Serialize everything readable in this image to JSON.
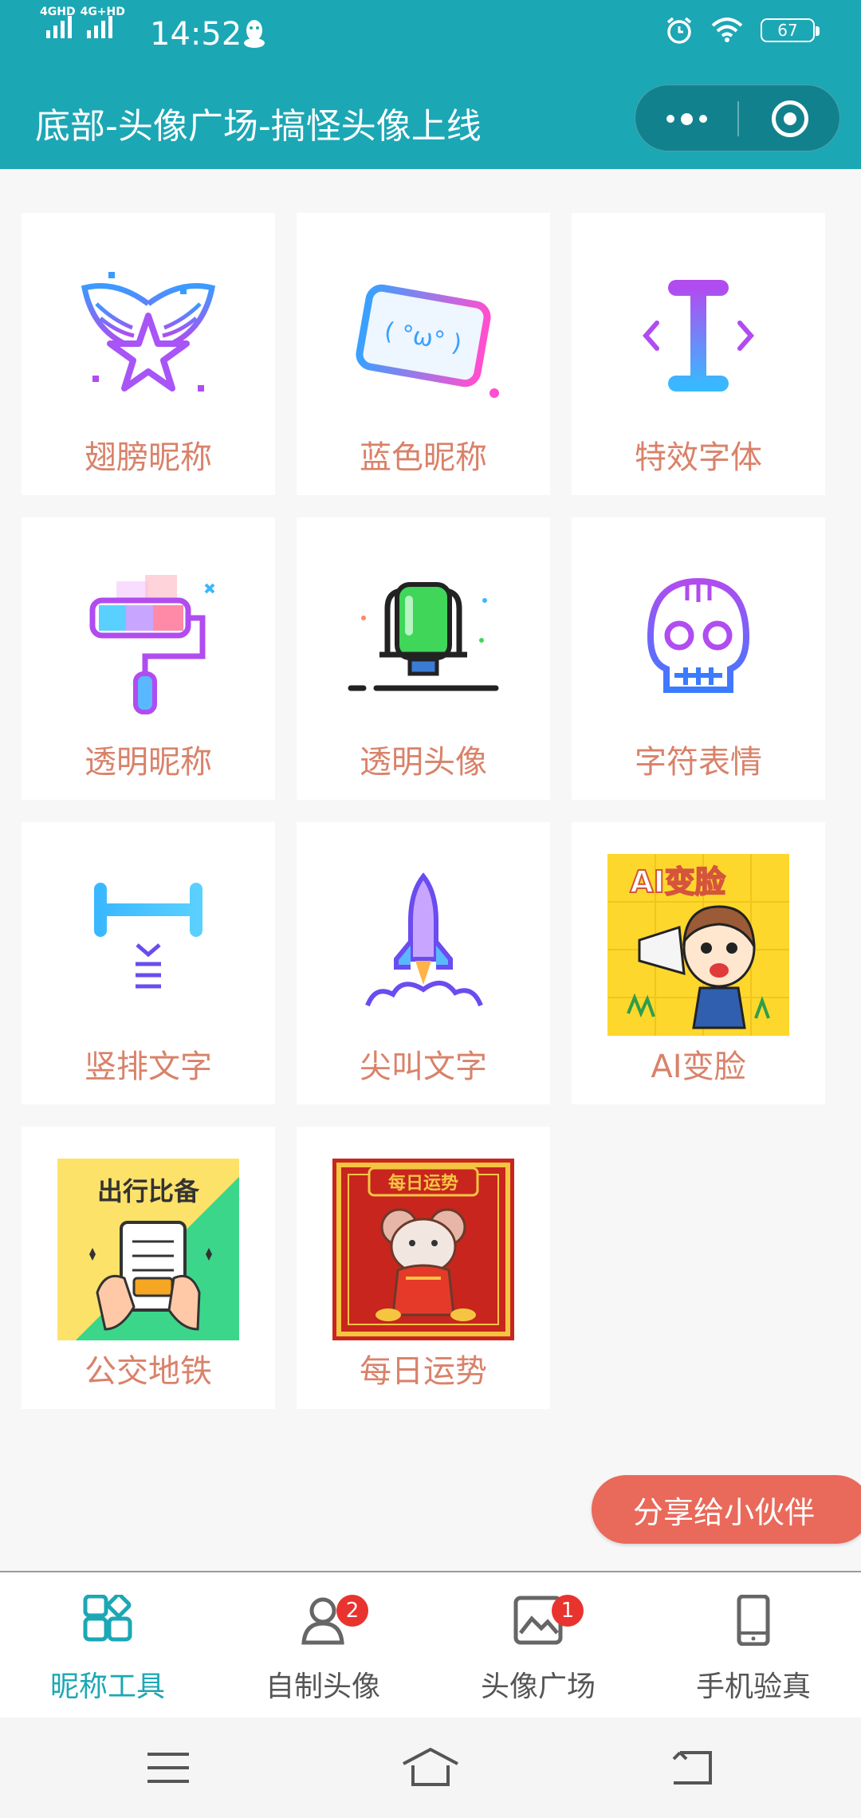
{
  "status_bar": {
    "network_1": "4GHD",
    "network_2": "4G+HD",
    "time": "14:52",
    "battery": "67"
  },
  "title_bar": {
    "title": "底部-头像广场-搞怪头像上线",
    "more_icon": "more-dots-icon",
    "close_icon": "target-close-icon"
  },
  "tools": [
    {
      "label": "翅膀昵称",
      "icon": "winged-star-icon"
    },
    {
      "label": "蓝色昵称",
      "icon": "kaomoji-tag-icon"
    },
    {
      "label": "特效字体",
      "icon": "text-cursor-icon"
    },
    {
      "label": "透明昵称",
      "icon": "paint-roller-icon"
    },
    {
      "label": "透明头像",
      "icon": "green-stamp-icon"
    },
    {
      "label": "字符表情",
      "icon": "skull-icon"
    },
    {
      "label": "竖排文字",
      "icon": "vertical-text-icon"
    },
    {
      "label": "尖叫文字",
      "icon": "rocket-icon"
    },
    {
      "label": "AI变脸",
      "icon": "ai-face-thumbnail",
      "image_text": "AI变脸"
    },
    {
      "label": "公交地铁",
      "icon": "transit-thumbnail",
      "image_text": "出行比备"
    },
    {
      "label": "每日运势",
      "icon": "fortune-thumbnail",
      "image_text": "每日运势"
    }
  ],
  "share_button": "分享给小伙伴",
  "tabs": [
    {
      "label": "昵称工具",
      "icon": "grid-apps-icon",
      "active": true,
      "badge": ""
    },
    {
      "label": "自制头像",
      "icon": "avatar-person-icon",
      "active": false,
      "badge": "2"
    },
    {
      "label": "头像广场",
      "icon": "gallery-image-icon",
      "active": false,
      "badge": "1"
    },
    {
      "label": "手机验真",
      "icon": "phone-icon",
      "active": false,
      "badge": ""
    }
  ],
  "colors": {
    "accent": "#1ca7b5",
    "label": "#d9826a",
    "share": "#e9695a",
    "badge": "#e8332e"
  }
}
